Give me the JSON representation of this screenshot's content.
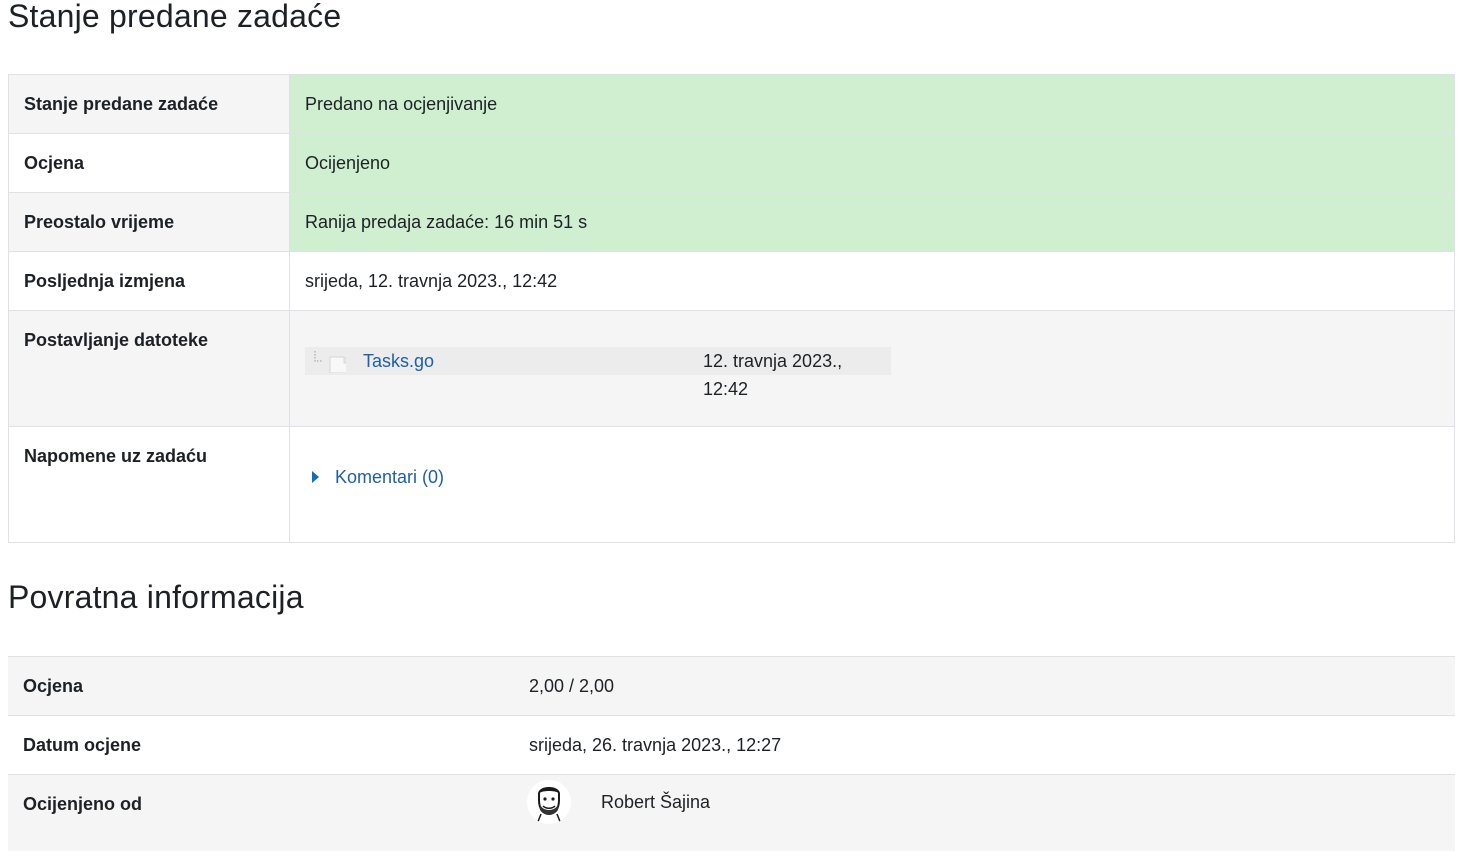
{
  "submission_status": {
    "title": "Stanje predane zadaće",
    "rows": [
      {
        "label": "Stanje predane zadaće",
        "value": "Predano na ocjenjivanje"
      },
      {
        "label": "Ocjena",
        "value": "Ocijenjeno"
      },
      {
        "label": "Preostalo vrijeme",
        "value": "Ranija predaja zadaće: 16 min 51 s"
      },
      {
        "label": "Posljednja izmjena",
        "value": "srijeda, 12. travnja 2023., 12:42"
      },
      {
        "label": "Postavljanje datoteke",
        "file_name": "Tasks.go",
        "file_date": "12. travnja 2023., 12:42"
      },
      {
        "label": "Napomene uz zadaću",
        "comments_link": "Komentari (0)"
      }
    ]
  },
  "feedback": {
    "title": "Povratna informacija",
    "rows": [
      {
        "label": "Ocjena",
        "value": "2,00 / 2,00"
      },
      {
        "label": "Datum ocjene",
        "value": "srijeda, 26. travnja 2023., 12:27"
      },
      {
        "label": "Ocijenjeno od",
        "value": "Robert Šajina"
      }
    ]
  },
  "colors": {
    "success_bg": "#cfefd0",
    "link": "#1f5fa8",
    "row_alt_bg": "#f5f5f5"
  },
  "icons": {
    "file": "document-icon",
    "expand": "caret-right-icon",
    "avatar": "user-avatar"
  }
}
